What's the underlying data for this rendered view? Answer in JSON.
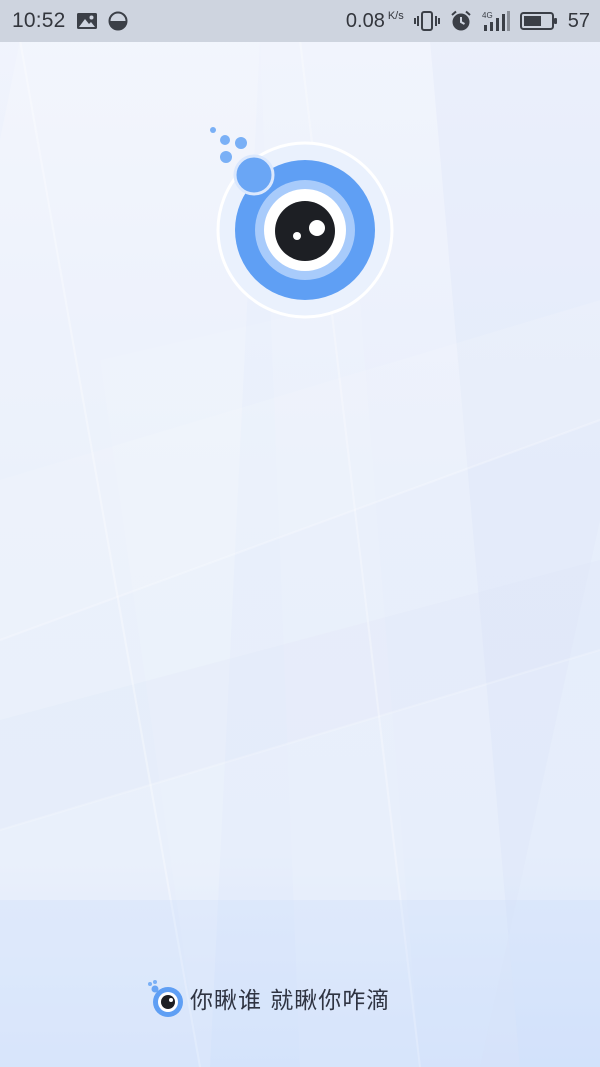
{
  "status_bar": {
    "time": "10:52",
    "net_speed_value": "0.08",
    "net_speed_unit": "K/s",
    "network_type": "4G",
    "battery_level": "57",
    "icons": [
      "image-icon",
      "data-saver-icon",
      "vibrate-icon",
      "alarm-icon",
      "signal-icon",
      "battery-icon"
    ]
  },
  "splash": {
    "logo": "eye-logo",
    "slogan": "你瞅谁 就瞅你咋滴",
    "colors": {
      "logo_blue": "#5b9bf3",
      "logo_light": "#9ec5fb",
      "pupil": "#1d1f24",
      "background": "#e9effb"
    }
  }
}
